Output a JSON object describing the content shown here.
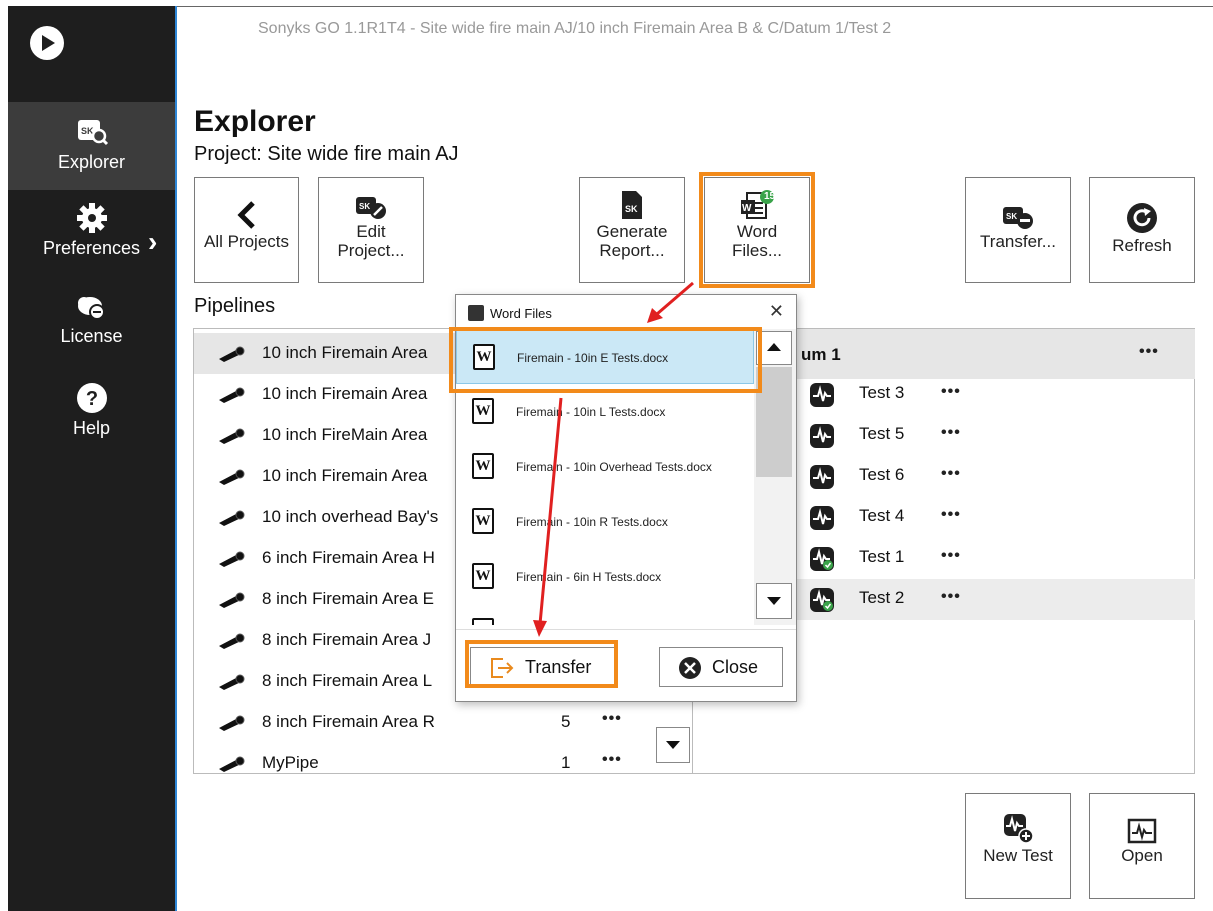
{
  "window": {
    "title": "Sonyks GO 1.1R1T4 - Site wide fire main AJ/10 inch Firemain Area B & C/Datum 1/Test 2"
  },
  "sidebar": {
    "items": [
      {
        "label": "Explorer",
        "icon": "explorer-icon",
        "active": true
      },
      {
        "label": "Preferences",
        "icon": "gear-icon"
      },
      {
        "label": "License",
        "icon": "license-icon"
      },
      {
        "label": "Help",
        "icon": "help-icon"
      }
    ]
  },
  "header": {
    "title": "Explorer",
    "project": "Project: Site wide fire main AJ"
  },
  "toolbar": {
    "all_projects": "All Projects",
    "edit_project_1": "Edit",
    "edit_project_2": "Project...",
    "generate_report_1": "Generate",
    "generate_report_2": "Report...",
    "word_files_1": "Word",
    "word_files_2": "Files...",
    "word_files_badge": "15",
    "transfer": "Transfer...",
    "refresh": "Refresh"
  },
  "pipelines": {
    "title": "Pipelines",
    "rows": [
      {
        "name": "10 inch Firemain Area",
        "count": ""
      },
      {
        "name": "10 inch Firemain Area",
        "count": ""
      },
      {
        "name": "10 inch FireMain Area",
        "count": ""
      },
      {
        "name": "10 inch Firemain Area",
        "count": ""
      },
      {
        "name": "10 inch overhead Bay's",
        "count": ""
      },
      {
        "name": "6 inch Firemain Area H",
        "count": ""
      },
      {
        "name": "8 inch Firemain Area E",
        "count": ""
      },
      {
        "name": "8 inch Firemain Area J",
        "count": ""
      },
      {
        "name": "8 inch Firemain Area L",
        "count": ""
      },
      {
        "name": "8 inch Firemain Area R",
        "count": "5"
      },
      {
        "name": "MyPipe",
        "count": "1"
      }
    ]
  },
  "tests": {
    "header": "um 1",
    "rows": [
      {
        "name": "Test 3",
        "checked": false
      },
      {
        "name": "Test 5",
        "checked": false
      },
      {
        "name": "Test 6",
        "checked": false
      },
      {
        "name": "Test 4",
        "checked": false
      },
      {
        "name": "Test 1",
        "checked": true
      },
      {
        "name": "Test 2",
        "checked": true
      }
    ]
  },
  "dialog": {
    "title": "Word Files",
    "files": [
      "Firemain - 10in E Tests.docx",
      "Firemain - 10in L Tests.docx",
      "Firemain - 10in Overhead Tests.docx",
      "Firemain - 10in R Tests.docx",
      "Firemain - 6in H Tests.docx"
    ],
    "transfer_label": "Transfer",
    "close_label": "Close"
  },
  "bottom": {
    "new_test": "New Test",
    "open": "Open"
  },
  "colors": {
    "accent_orange": "#f28a1a",
    "arrow_red": "#e02020",
    "sidebar": "#1e1e1e",
    "selection_blue": "#cbe8f6"
  }
}
